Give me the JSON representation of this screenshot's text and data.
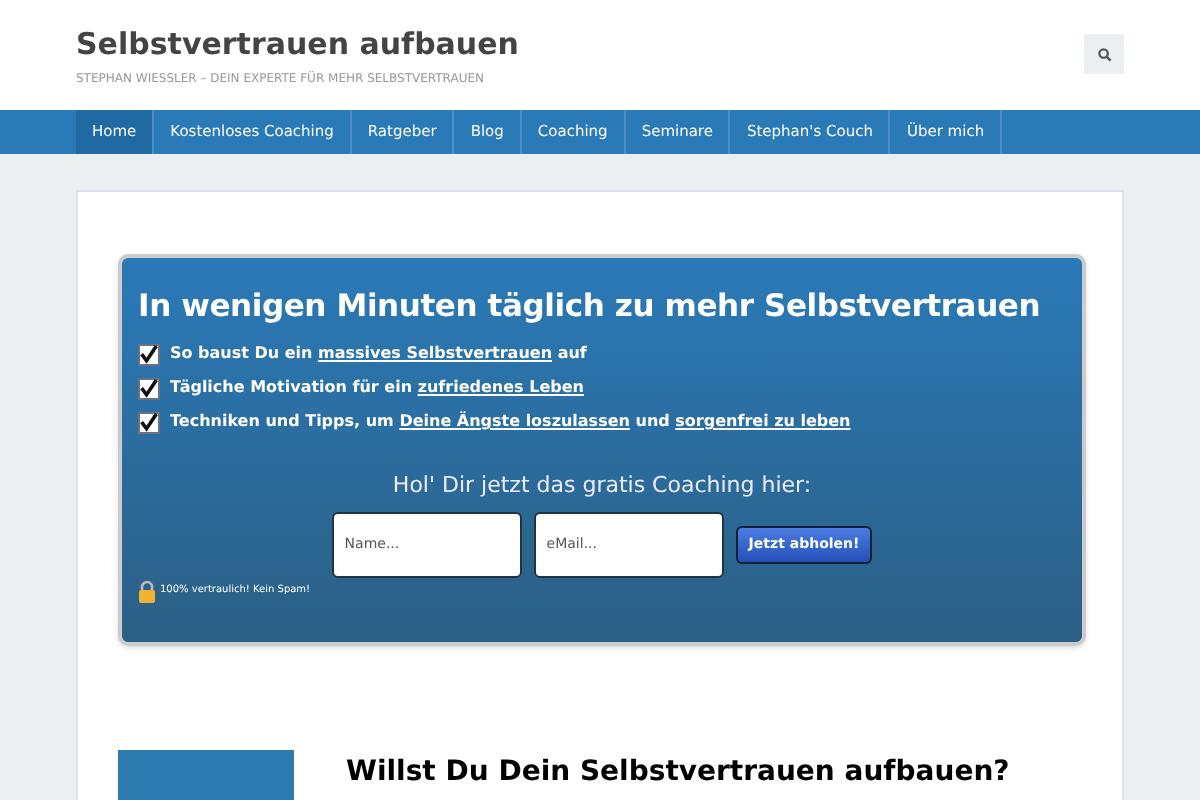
{
  "site": {
    "title": "Selbstvertrauen aufbauen",
    "tagline": "STEPHAN WIESSLER – DEIN EXPERTE FÜR MEHR SELBSTVERTRAUEN"
  },
  "nav": [
    {
      "label": "Home",
      "selected": true
    },
    {
      "label": "Kostenloses Coaching",
      "selected": false
    },
    {
      "label": "Ratgeber",
      "selected": false
    },
    {
      "label": "Blog",
      "selected": false
    },
    {
      "label": "Coaching",
      "selected": false
    },
    {
      "label": "Seminare",
      "selected": false
    },
    {
      "label": "Stephan's Couch",
      "selected": false
    },
    {
      "label": "Über mich",
      "selected": false
    }
  ],
  "optin": {
    "headline": "In wenigen Minuten täglich zu mehr Selbstvertrauen",
    "benefits": [
      {
        "checked": true,
        "parts": [
          {
            "kind": "text",
            "text": "So baust Du ein"
          },
          {
            "kind": "link",
            "text": "massives Selbstvertrauen"
          },
          {
            "kind": "text",
            "text": "auf"
          }
        ]
      },
      {
        "checked": true,
        "parts": [
          {
            "kind": "text",
            "text": "Tägliche Motivation für ein"
          },
          {
            "kind": "link",
            "text": "zufriedenes Leben"
          }
        ]
      },
      {
        "checked": true,
        "parts": [
          {
            "kind": "text",
            "text": "Techniken und Tipps, um"
          },
          {
            "kind": "link",
            "text": "Deine Ängste loszulassen"
          },
          {
            "kind": "text",
            "text": "und"
          },
          {
            "kind": "link",
            "text": "sorgenfrei zu leben"
          }
        ]
      }
    ],
    "cta": "Hol' Dir jetzt das gratis Coaching hier:",
    "name_field": {
      "placeholder": "Name..."
    },
    "email_field": {
      "placeholder": "eMail..."
    },
    "button": "Jetzt abholen!",
    "privacy": "100% vertraulich! Kein Spam!"
  },
  "article": {
    "heading": "Willst Du Dein Selbstvertrauen aufbauen?"
  }
}
